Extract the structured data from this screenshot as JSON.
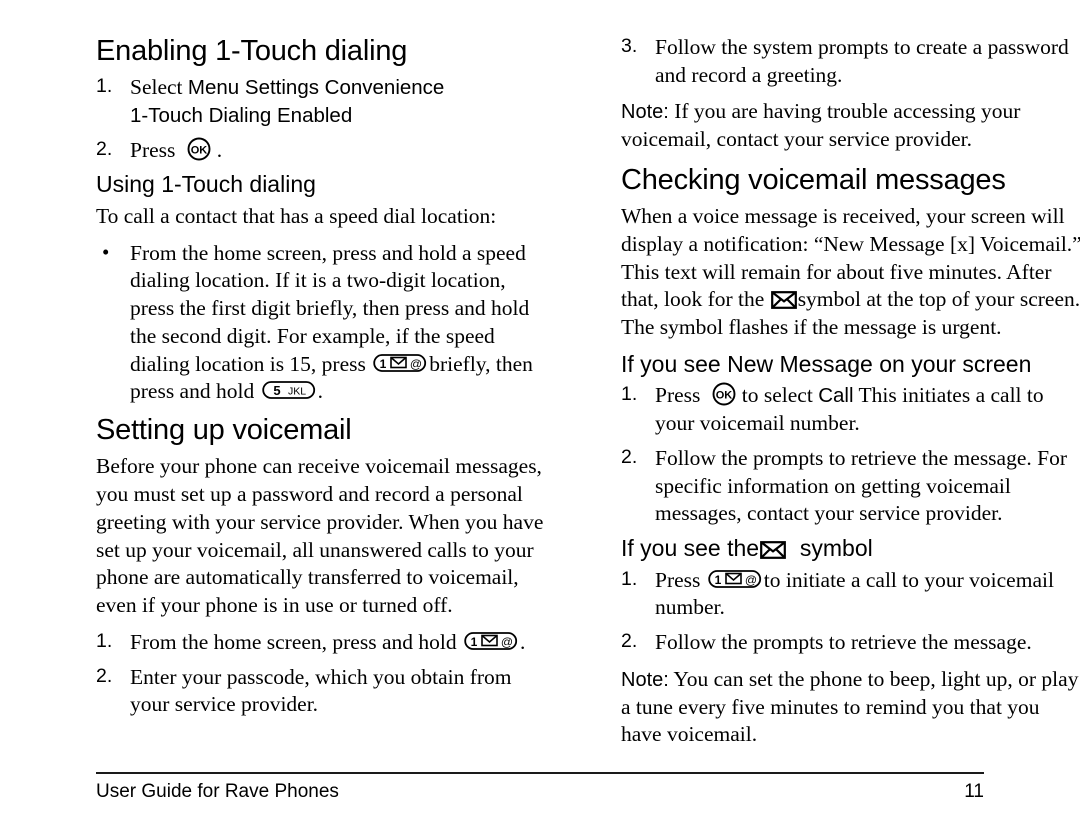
{
  "document": {
    "footer": {
      "left_text": "User Guide for Rave Phones",
      "page_number": "11"
    }
  },
  "left_column": {
    "heading_1": "Enabling 1-Touch dialing",
    "steps_1": [
      {
        "number": "1.",
        "lead": "Select",
        "ui_path_line1": "Menu    Settings    Convenience",
        "ui_path_line2": "1-Touch Dialing   Enabled"
      },
      {
        "number": "2.",
        "lead": "Press",
        "key": "ok-key",
        "trail": "."
      }
    ],
    "subheading_1": "Using 1-Touch dialing",
    "intro_1": "To call a contact that has a speed dial location:",
    "bullet_1": {
      "marker": "•",
      "text_part1": "From the home screen, press and hold a speed dialing location. If it is a two-digit location, press the first digit briefly, then press and hold the second digit. For example, if the speed dialing location is 15, press",
      "key1": "one-key",
      "text_part2": "briefly, then press and hold",
      "key2": "five-key",
      "text_part3": "."
    },
    "heading_2": "Setting up voicemail",
    "paragraph_1": "Before your phone can receive voicemail messages, you must set up a password and record a personal greeting with your service provider. When you have set up your voicemail, all unanswered calls to your phone are automatically transferred to voicemail, even if your phone is in use or turned off.",
    "steps_2": [
      {
        "number": "1.",
        "text_part1": "From the home screen, press and hold",
        "key": "one-key",
        "text_part2": "."
      },
      {
        "number": "2.",
        "text_part1": "Enter your passcode, which you obtain from your service provider.",
        "key": "",
        "text_part2": ""
      }
    ]
  },
  "right_column": {
    "step_3": {
      "number": "3.",
      "text": "Follow the system prompts to create a password and record a greeting."
    },
    "note_1": {
      "label": "Note:",
      "text": "If you are having trouble accessing your voicemail, contact your service provider."
    },
    "heading_1": "Checking voicemail messages",
    "paragraph_1_part1": "When a voice message is received, your screen will display a notification: “New Message [x] Voicemail.” This text will remain for about five minutes. After that, look for the",
    "paragraph_1_part2": "symbol at the top of your screen. The symbol flashes if the message is urgent.",
    "subheading_1": "If you see  New Message  on your screen",
    "steps_1": [
      {
        "number": "1.",
        "text_part1": "Press",
        "key": "ok-key",
        "text_part2": "to select",
        "ui_label": "Call",
        "text_part3": "This initiates a call to your voicemail number."
      },
      {
        "number": "2.",
        "text_part1": "Follow the prompts to retrieve the message. For specific information on getting voicemail messages, contact your service provider.",
        "key": "",
        "text_part2": "",
        "ui_label": "",
        "text_part3": ""
      }
    ],
    "subheading_2_part1": "If you see the",
    "subheading_2_part2": "symbol",
    "steps_2": [
      {
        "number": "1.",
        "text_part1": "Press",
        "key": "one-key",
        "text_part2": "to initiate a call to your voicemail number."
      },
      {
        "number": "2.",
        "text_part1": "Follow the prompts to retrieve the message.",
        "key": "",
        "text_part2": ""
      }
    ],
    "note_2": {
      "label": "Note:",
      "text": "You can set the phone to beep, light up, or play a tune every five minutes to remind you that you have voicemail."
    }
  },
  "key_glyphs": {
    "ok_key_label": "OK",
    "one_key_digit": "1",
    "one_key_at": "@",
    "five_key_digit": "5",
    "five_key_letters": "JKL"
  },
  "colors": {
    "text": "#000000",
    "background": "#ffffff",
    "rule": "#1a1a1a"
  }
}
